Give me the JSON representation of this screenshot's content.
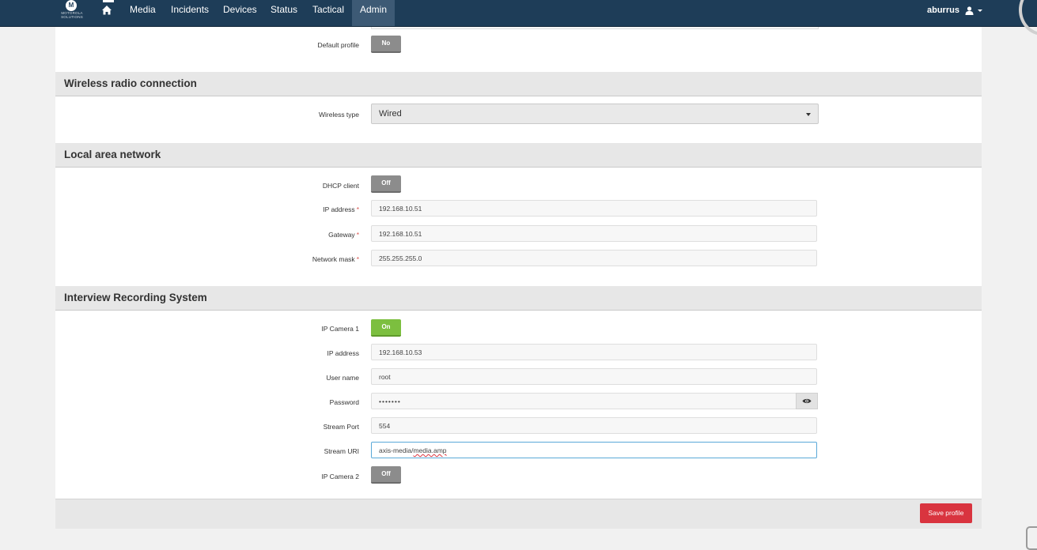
{
  "nav": {
    "logo_text": "MOTOROLA SOLUTIONS",
    "logo_letter": "M",
    "items": [
      {
        "label": "Media"
      },
      {
        "label": "Incidents"
      },
      {
        "label": "Devices"
      },
      {
        "label": "Status"
      },
      {
        "label": "Tactical"
      },
      {
        "label": "Admin",
        "active": true
      }
    ],
    "user": "aburrus"
  },
  "top": {
    "default_profile_label": "Default profile",
    "default_profile_value": "No"
  },
  "wireless": {
    "title": "Wireless radio connection",
    "type_label": "Wireless type",
    "type_value": "Wired"
  },
  "lan": {
    "title": "Local area network",
    "dhcp_label": "DHCP client",
    "dhcp_value": "Off",
    "ip_label": "IP address",
    "ip_value": "192.168.10.51",
    "gateway_label": "Gateway",
    "gateway_value": "192.168.10.51",
    "mask_label": "Network mask",
    "mask_value": "255.255.255.0",
    "required_mark": "*"
  },
  "irs": {
    "title": "Interview Recording System",
    "cam1_label": "IP Camera 1",
    "cam1_value": "On",
    "ip_label": "IP address",
    "ip_value": "192.168.10.53",
    "user_label": "User name",
    "user_value": "root",
    "password_label": "Password",
    "password_value": "•••••••",
    "port_label": "Stream Port",
    "port_value": "554",
    "uri_label": "Stream URI",
    "uri_value_a": "axis-media/",
    "uri_value_b": "media.amp",
    "cam2_label": "IP Camera 2",
    "cam2_value": "Off"
  },
  "footer": {
    "save_label": "Save profile"
  },
  "colors": {
    "navbar": "#1e3d58",
    "toggle_on": "#7cbf3f",
    "toggle_off": "#8c8c8c",
    "save": "#d9343f"
  }
}
